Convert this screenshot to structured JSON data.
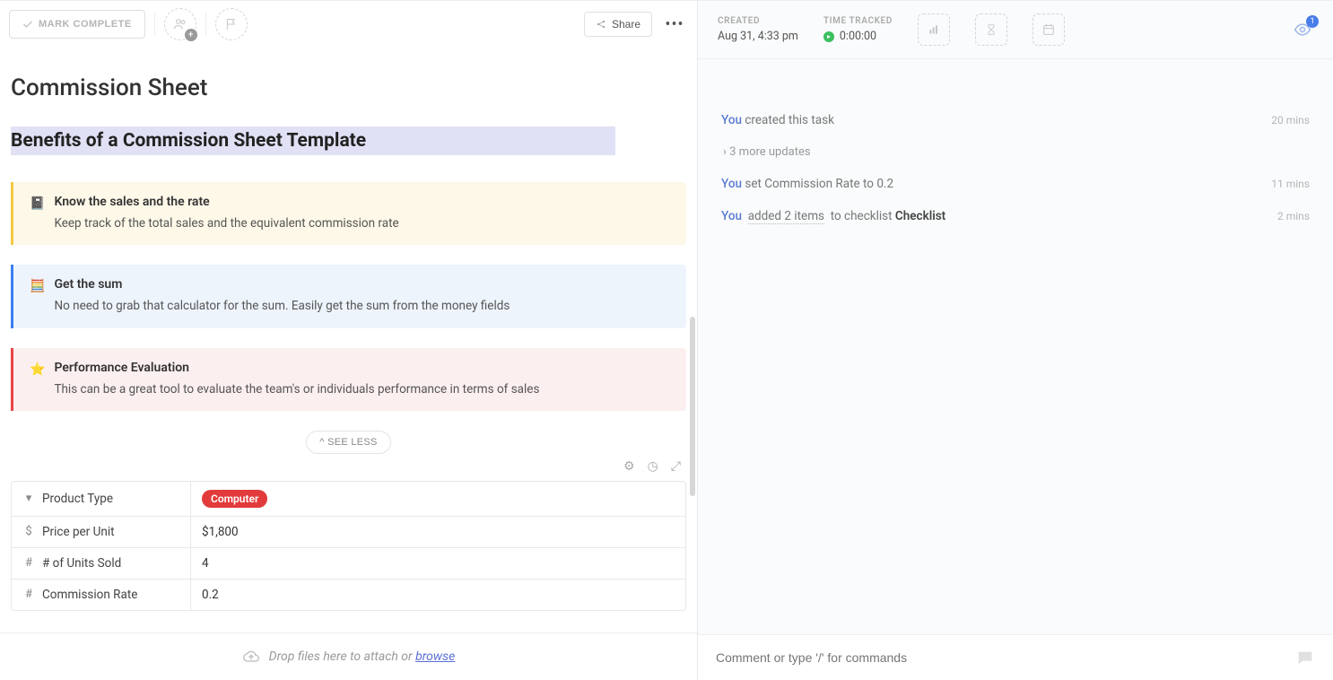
{
  "header": {
    "mark_complete": "MARK COMPLETE",
    "share": "Share"
  },
  "page_title": "Commission Sheet",
  "benefits_title": "Benefits of a Commission Sheet Template",
  "callouts": [
    {
      "icon": "📓",
      "title": "Know the sales and the rate",
      "desc": "Keep track of the total sales and the equivalent commission rate"
    },
    {
      "icon": "🧮",
      "title": "Get the sum",
      "desc": "No need to grab that calculator for the sum. Easily get the sum from the money fields"
    },
    {
      "icon": "⭐",
      "title": "Performance Evaluation",
      "desc": "This can be a great tool to evaluate the team's or individuals performance in terms of sales"
    }
  ],
  "see_less": "^ SEE LESS",
  "fields": [
    {
      "icon": "▾",
      "label": "Product Type",
      "value": "Computer",
      "is_tag": true
    },
    {
      "icon": "$",
      "label": "Price per Unit",
      "value": "$1,800"
    },
    {
      "icon": "#",
      "label": "# of Units Sold",
      "value": "4"
    },
    {
      "icon": "#",
      "label": "Commission Rate",
      "value": "0.2"
    }
  ],
  "dropzone": {
    "text": "Drop files here to attach or ",
    "link": "browse"
  },
  "right_meta": {
    "created_label": "CREATED",
    "created_value": "Aug 31, 4:33 pm",
    "time_label": "TIME TRACKED",
    "time_value": "0:00:00",
    "watch_count": "1"
  },
  "activity": [
    {
      "you": "You",
      "rest": " created this task",
      "time": "20 mins"
    }
  ],
  "more_updates": "3 more updates",
  "activity2": [
    {
      "you": "You",
      "rest": " set Commission Rate to 0.2",
      "time": "11 mins"
    }
  ],
  "activity3": {
    "you": "You",
    "dotted": "added 2 items",
    "mid": " to checklist ",
    "strong": "Checklist",
    "time": "2 mins"
  },
  "comment_placeholder": "Comment or type '/' for commands"
}
